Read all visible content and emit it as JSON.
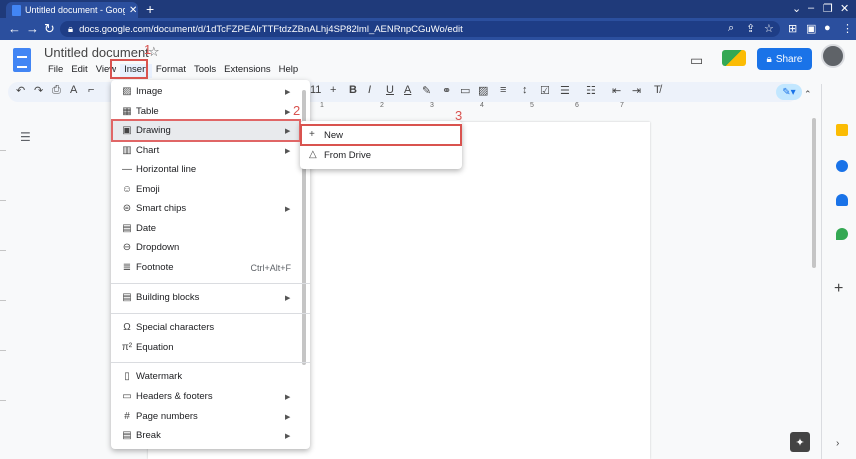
{
  "browser": {
    "tab_title": "Untitled document - Google Docs",
    "url": "docs.google.com/document/d/1dTcFZPEAlrTTFtdzZBnALhj4SP82lml_AENRnpCGuWo/edit"
  },
  "doc": {
    "title": "Untitled document",
    "menu": [
      "File",
      "Edit",
      "View",
      "Insert",
      "Format",
      "Tools",
      "Extensions",
      "Help"
    ],
    "share_label": "Share",
    "font_size": "11"
  },
  "ruler": [
    "1",
    "2",
    "3",
    "4",
    "5",
    "6",
    "7"
  ],
  "insert_menu": {
    "items": [
      {
        "icon": "image-icon",
        "label": "Image",
        "submenu": true
      },
      {
        "icon": "table-icon",
        "label": "Table",
        "submenu": true
      },
      {
        "icon": "drawing-icon",
        "label": "Drawing",
        "submenu": true
      },
      {
        "icon": "chart-icon",
        "label": "Chart",
        "submenu": true
      },
      {
        "icon": "horizontal-line-icon",
        "label": "Horizontal line",
        "submenu": false
      },
      {
        "icon": "emoji-icon",
        "label": "Emoji",
        "submenu": false
      },
      {
        "icon": "smart-chips-icon",
        "label": "Smart chips",
        "submenu": true
      },
      {
        "icon": "date-icon",
        "label": "Date",
        "submenu": false
      },
      {
        "icon": "dropdown-icon",
        "label": "Dropdown",
        "submenu": false
      },
      {
        "icon": "footnote-icon",
        "label": "Footnote",
        "shortcut": "Ctrl+Alt+F",
        "submenu": false
      },
      {
        "icon": "building-blocks-icon",
        "label": "Building blocks",
        "submenu": true
      },
      {
        "icon": "special-characters-icon",
        "label": "Special characters",
        "submenu": false
      },
      {
        "icon": "equation-icon",
        "label": "Equation",
        "submenu": false
      },
      {
        "icon": "watermark-icon",
        "label": "Watermark",
        "submenu": false
      },
      {
        "icon": "headers-footers-icon",
        "label": "Headers & footers",
        "submenu": true
      },
      {
        "icon": "page-numbers-icon",
        "label": "Page numbers",
        "submenu": true
      },
      {
        "icon": "break-icon",
        "label": "Break",
        "submenu": true
      }
    ]
  },
  "drawing_submenu": {
    "items": [
      {
        "icon": "plus-icon",
        "label": "New"
      },
      {
        "icon": "drive-icon",
        "label": "From Drive"
      }
    ]
  },
  "annotations": {
    "step1": "1",
    "step2": "2",
    "step3": "3",
    "color": "#d9534f"
  }
}
